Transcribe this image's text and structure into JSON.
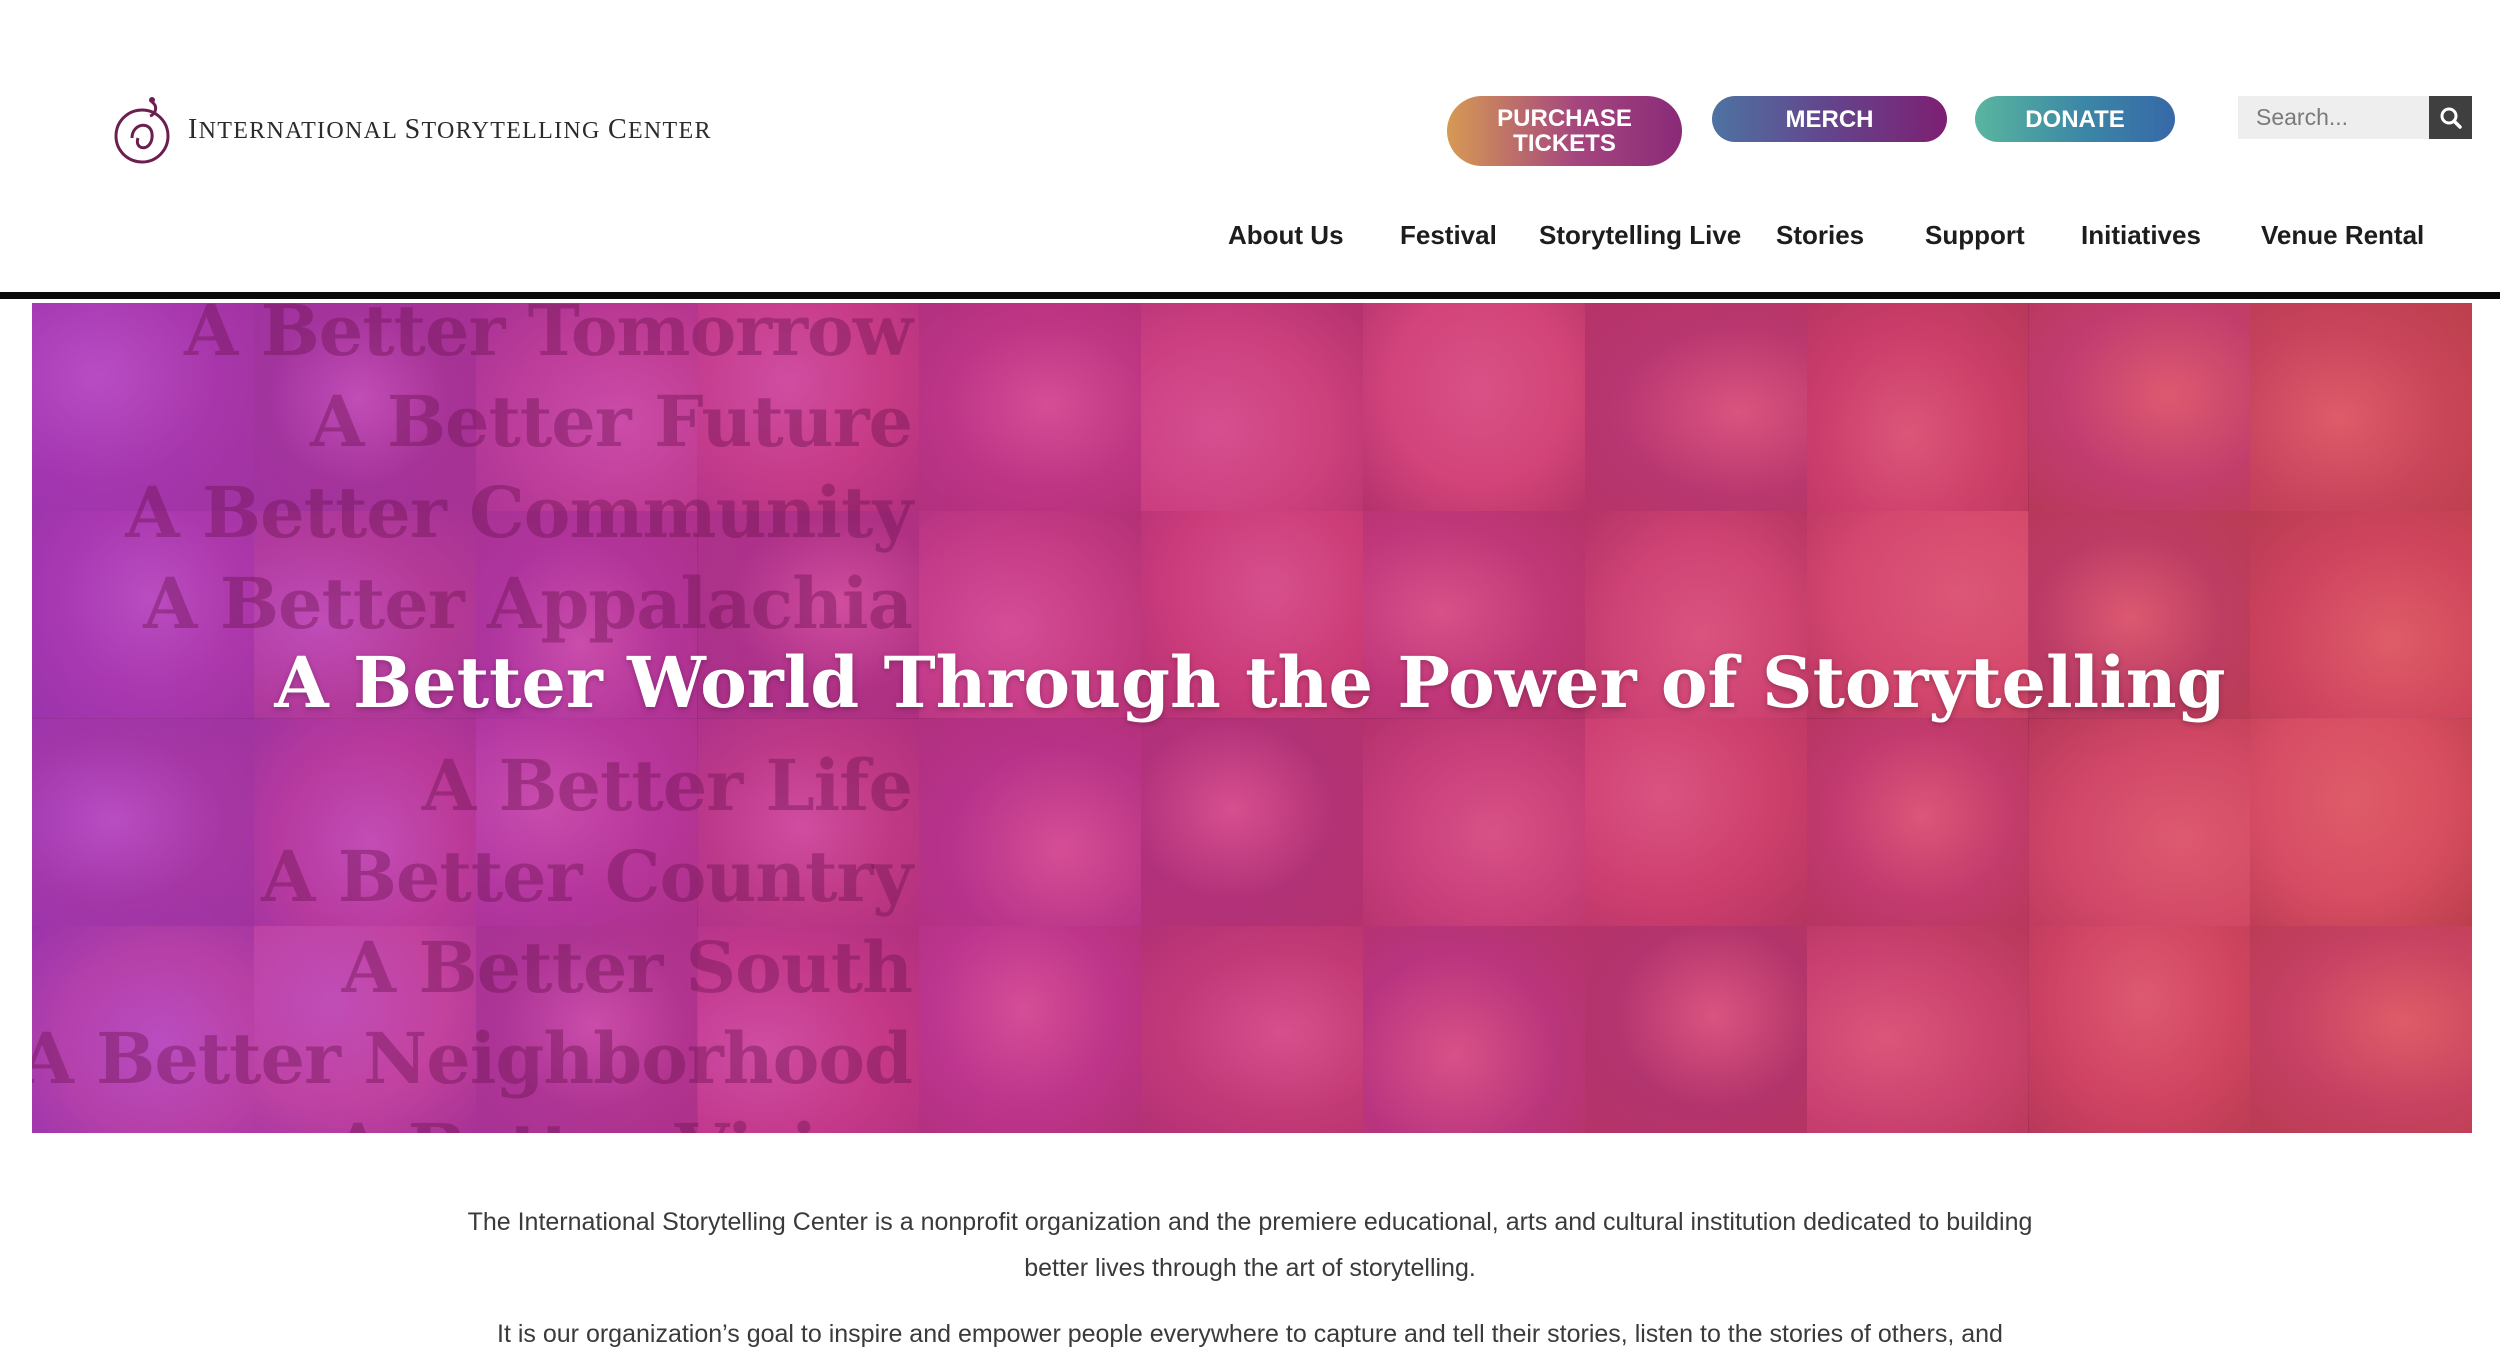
{
  "header": {
    "logo_text_prefix_I": "I",
    "logo_text_rest1": "NTERNATIONAL ",
    "logo_text_S": "S",
    "logo_text_rest2": "TORYTELLING ",
    "logo_text_C": "C",
    "logo_text_rest3": "ENTER",
    "buttons": {
      "tickets": "PURCHASE\nTICKETS",
      "merch": "MERCH",
      "donate": "DONATE"
    },
    "search": {
      "placeholder": "Search..."
    },
    "nav": [
      "About Us",
      "Festival",
      "Storytelling Live",
      "Stories",
      "Support",
      "Initiatives",
      "Venue Rental"
    ]
  },
  "hero": {
    "title": "A Better World Through the Power of Storytelling",
    "lines": [
      "A Better Tomorrow",
      "A Better Future",
      "A Better Community",
      "A Better Appalachia",
      "",
      "A Better Life",
      "A Better Country",
      "A Better South",
      "A Better Neighborhood",
      "A Better Vision"
    ]
  },
  "intro": {
    "p1": "The International Storytelling Center is a nonprofit organization and the premiere educational, arts and cultural institution dedicated to building better lives through the art of storytelling.",
    "p2": "It is our organization’s goal to inspire and empower people everywhere to capture and tell their stories, listen to the stories of others, and"
  },
  "colors": {
    "accent_purple": "#7e1f72",
    "accent_teal": "#5ab69f",
    "hero_pink": "#c93c9a"
  }
}
